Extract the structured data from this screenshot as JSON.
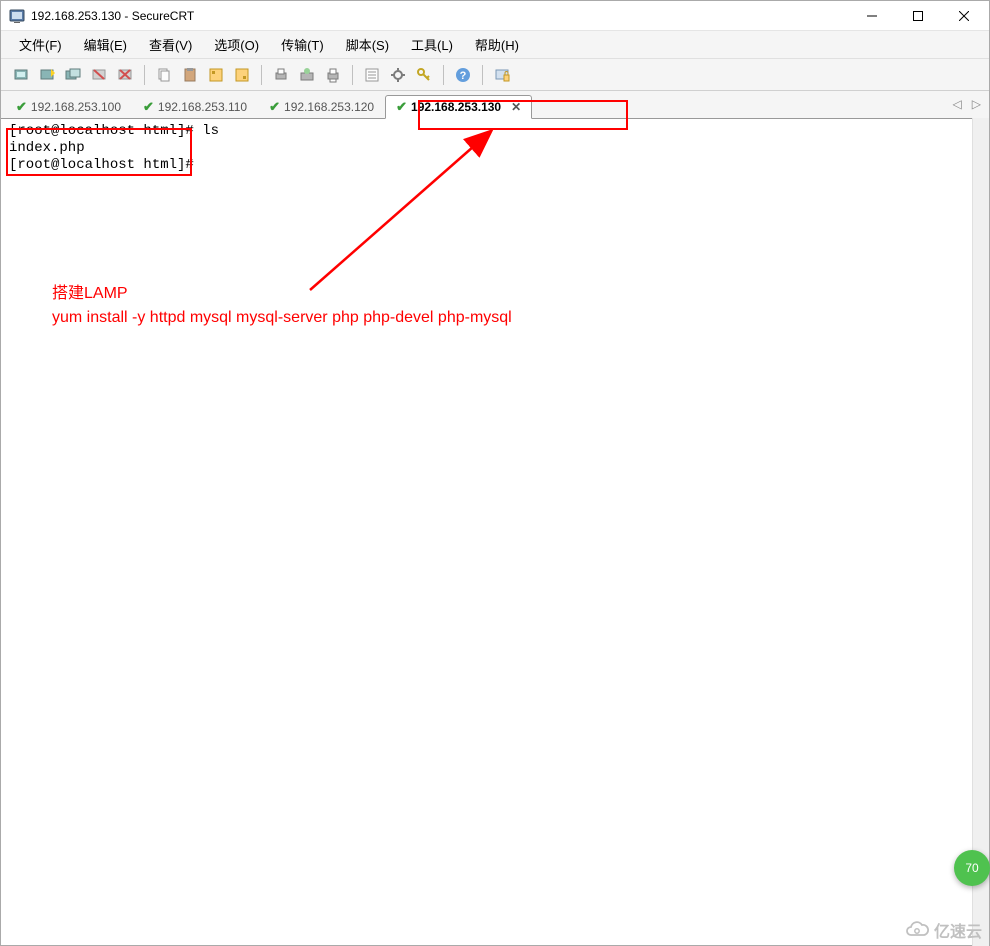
{
  "window": {
    "title": "192.168.253.130 - SecureCRT"
  },
  "menu": {
    "file": "文件(F)",
    "edit": "编辑(E)",
    "view": "查看(V)",
    "options": "选项(O)",
    "transfer": "传输(T)",
    "script": "脚本(S)",
    "tools": "工具(L)",
    "help": "帮助(H)"
  },
  "tabs": [
    {
      "label": "192.168.253.100",
      "active": false
    },
    {
      "label": "192.168.253.110",
      "active": false
    },
    {
      "label": "192.168.253.120",
      "active": false
    },
    {
      "label": "192.168.253.130",
      "active": true
    }
  ],
  "terminal": {
    "line1": "[root@localhost html]# ls",
    "line2": "index.php",
    "line3": "[root@localhost html]#"
  },
  "annotation": {
    "line1": "搭建LAMP",
    "line2": "yum install -y httpd mysql mysql-server php php-devel php-mysql"
  },
  "badge": {
    "text": "70"
  },
  "watermark": {
    "text": "亿速云"
  }
}
